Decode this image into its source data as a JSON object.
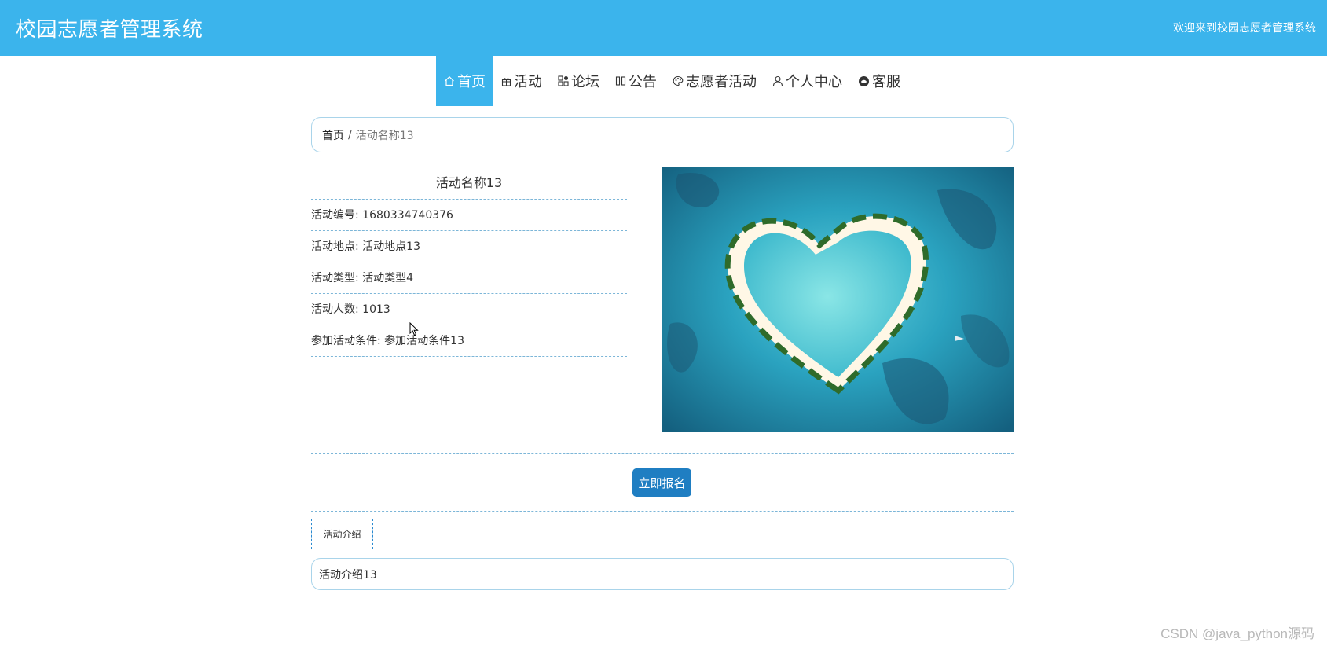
{
  "header": {
    "title": "校园志愿者管理系统",
    "welcome": "欢迎来到校园志愿者管理系统"
  },
  "nav": {
    "items": [
      {
        "label": "首页",
        "icon": "home-icon",
        "active": true
      },
      {
        "label": "活动",
        "icon": "gift-icon",
        "active": false
      },
      {
        "label": "论坛",
        "icon": "grid-icon",
        "active": false
      },
      {
        "label": "公告",
        "icon": "book-icon",
        "active": false
      },
      {
        "label": "志愿者活动",
        "icon": "palette-icon",
        "active": false
      },
      {
        "label": "个人中心",
        "icon": "user-icon",
        "active": false
      },
      {
        "label": "客服",
        "icon": "chat-icon",
        "active": false
      }
    ]
  },
  "breadcrumb": {
    "home": "首页",
    "separator": "/",
    "current": "活动名称13"
  },
  "activity": {
    "name": "活动名称13",
    "fields": [
      {
        "label": "活动编号:",
        "value": "1680334740376"
      },
      {
        "label": "活动地点:",
        "value": "活动地点13"
      },
      {
        "label": "活动类型:",
        "value": "活动类型4"
      },
      {
        "label": "活动人数:",
        "value": "1013"
      },
      {
        "label": "参加活动条件:",
        "value": "参加活动条件13"
      }
    ],
    "signup_label": "立即报名",
    "tab_label": "活动介绍",
    "intro": "活动介绍13"
  },
  "colors": {
    "header_bg": "#3bb4ec",
    "button_bg": "#1f7ec2",
    "border": "#a9d4ea"
  },
  "watermark": "CSDN @java_python源码"
}
